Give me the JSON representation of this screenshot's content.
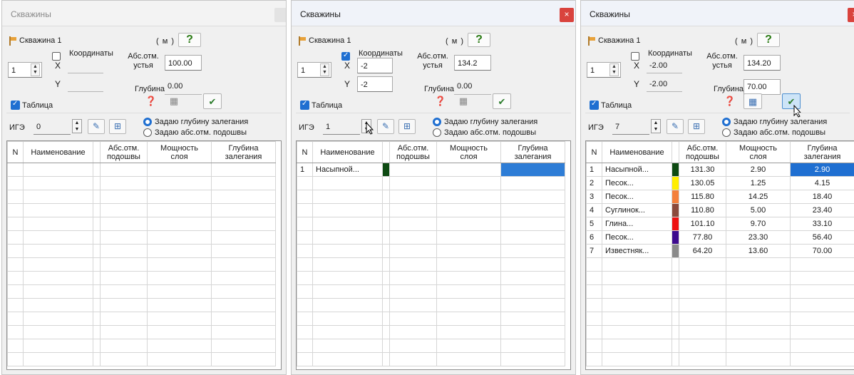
{
  "window_title": "Скважины",
  "close_glyph": "×",
  "well_name": "Скважина 1",
  "unit": "( м )",
  "help_glyph": "?",
  "well_number": "1",
  "labels": {
    "coordinates": "Координаты",
    "x": "X",
    "y": "Y",
    "abs_mouth_1": "Абс.отм.",
    "abs_mouth_2": "устья",
    "depth": "Глубина",
    "table": "Таблица",
    "ige": "ИГЭ",
    "radio_depth": "Задаю глубину залегания",
    "radio_abs": "Задаю абс.отм. подошвы"
  },
  "columns": {
    "n": "N",
    "name": "Наименование",
    "abs_1": "Абс.отм.",
    "abs_2": "подошвы",
    "thick_1": "Мощность",
    "thick_2": "слоя",
    "depth_1": "Глубина",
    "depth_2": "залегания"
  },
  "panels": [
    {
      "state": "inactive",
      "coords_checked": false,
      "x": "",
      "y": "",
      "abs_mouth": "100.00",
      "depth": "0.00",
      "ige": "0",
      "rows": []
    },
    {
      "state": "active",
      "coords_checked": true,
      "x": "-2",
      "y": "-2",
      "abs_mouth": "134.2",
      "depth": "0.00",
      "ige": "1",
      "rows": [
        {
          "n": "1",
          "name": "Насыпной...",
          "color": "#0d4a12",
          "abs": "",
          "thick": "",
          "depth": ""
        }
      ]
    },
    {
      "state": "active",
      "coords_checked": false,
      "x": "-2.00",
      "y": "-2.00",
      "abs_mouth": "134.20",
      "depth": "70.00",
      "ige": "7",
      "rows": [
        {
          "n": "1",
          "name": "Насыпной...",
          "color": "#0d4a12",
          "abs": "131.30",
          "thick": "2.90",
          "depth": "2.90"
        },
        {
          "n": "2",
          "name": "Песок...",
          "color": "#ffee00",
          "abs": "130.05",
          "thick": "1.25",
          "depth": "4.15"
        },
        {
          "n": "3",
          "name": "Песок...",
          "color": "#f47f3b",
          "abs": "115.80",
          "thick": "14.25",
          "depth": "18.40"
        },
        {
          "n": "4",
          "name": "Суглинок...",
          "color": "#8b4a3c",
          "abs": "110.80",
          "thick": "5.00",
          "depth": "23.40"
        },
        {
          "n": "5",
          "name": "Глина...",
          "color": "#ee1111",
          "abs": "101.10",
          "thick": "9.70",
          "depth": "33.10"
        },
        {
          "n": "6",
          "name": "Песок...",
          "color": "#3d0a8e",
          "abs": "77.80",
          "thick": "23.30",
          "depth": "56.40"
        },
        {
          "n": "7",
          "name": "Известняк...",
          "color": "#8a8a8a",
          "abs": "64.20",
          "thick": "13.60",
          "depth": "70.00"
        }
      ]
    }
  ]
}
